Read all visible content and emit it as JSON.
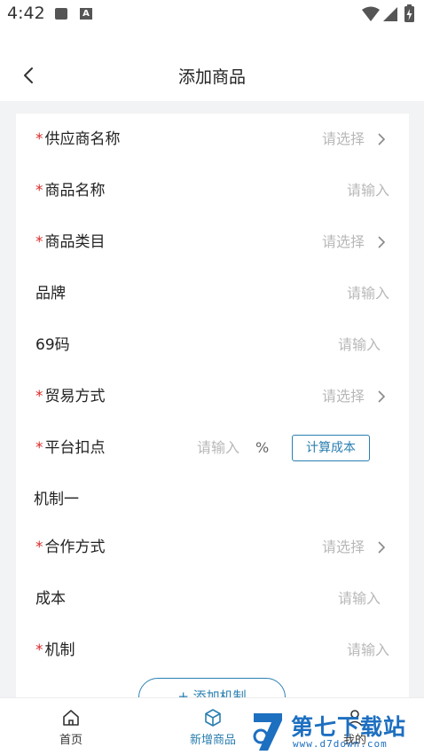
{
  "status_bar": {
    "time": "4:42"
  },
  "nav": {
    "title": "添加商品"
  },
  "form": {
    "required_mark": "*",
    "supplier": {
      "label": "供应商名称",
      "placeholder": "请选择"
    },
    "product_name": {
      "label": "商品名称",
      "placeholder": "请输入"
    },
    "category": {
      "label": "商品类目",
      "placeholder": "请选择"
    },
    "brand": {
      "label": "品牌",
      "placeholder": "请输入"
    },
    "code69": {
      "label": "69码",
      "placeholder": "请输入"
    },
    "trade_mode": {
      "label": "贸易方式",
      "placeholder": "请选择"
    },
    "platform_discount": {
      "label": "平台扣点",
      "placeholder": "请输入",
      "unit": "%",
      "calc_button": "计算成本"
    },
    "mechanism_section": "机制一",
    "cooperation_mode": {
      "label": "合作方式",
      "placeholder": "请选择"
    },
    "cost": {
      "label": "成本",
      "placeholder": "请输入"
    },
    "mechanism": {
      "label": "机制",
      "placeholder": "请输入"
    },
    "add_mechanism_button": "+ 添加机制"
  },
  "tab_bar": {
    "tabs": [
      {
        "label": "首页",
        "icon": "home-icon",
        "active": false
      },
      {
        "label": "新增商品",
        "icon": "box-icon",
        "active": true
      },
      {
        "label": "我的",
        "icon": "user-icon",
        "active": false
      }
    ]
  },
  "watermark": {
    "title": "第七下载站",
    "url": "www.d7down.com"
  },
  "colors": {
    "accent": "#2a7fb0",
    "required": "#d92b2b",
    "placeholder": "#b8b8b8",
    "background": "#f2f3f5"
  }
}
